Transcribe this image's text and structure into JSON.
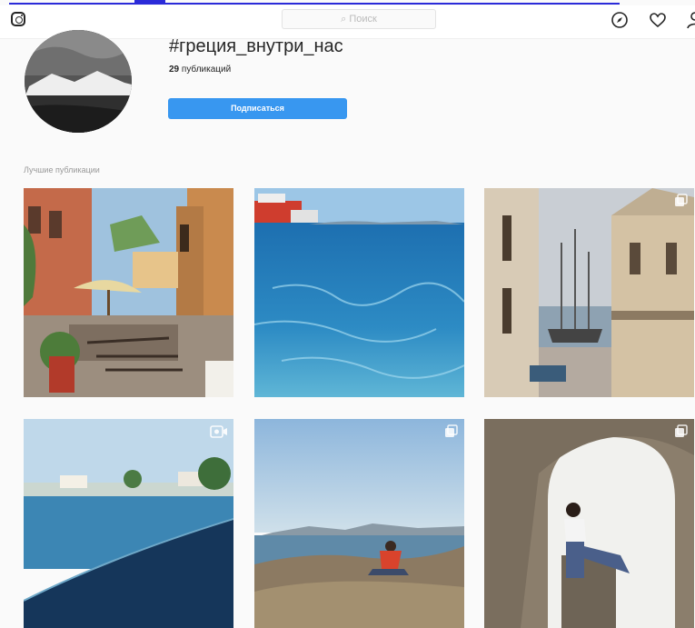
{
  "search": {
    "placeholder": "Поиск"
  },
  "hashtag": {
    "title": "#греция_внутри_нас",
    "post_count": "29",
    "post_count_label": "публикаций",
    "follow_label": "Подписаться"
  },
  "section": {
    "top_posts_label": "Лучшие публикации"
  },
  "posts": [
    {
      "subject": "cafe-terrace",
      "badge": "none"
    },
    {
      "subject": "blue-sea",
      "badge": "none"
    },
    {
      "subject": "harbor-street",
      "badge": "gallery"
    },
    {
      "subject": "coastline",
      "badge": "video"
    },
    {
      "subject": "rocky-beach",
      "badge": "gallery"
    },
    {
      "subject": "stone-arch",
      "badge": "gallery"
    }
  ],
  "icons": [
    "instagram-logo",
    "explore-icon",
    "heart-icon",
    "profile-icon"
  ],
  "colors": {
    "accent": "#3897f0",
    "text": "#262626",
    "background": "#fafafa"
  }
}
